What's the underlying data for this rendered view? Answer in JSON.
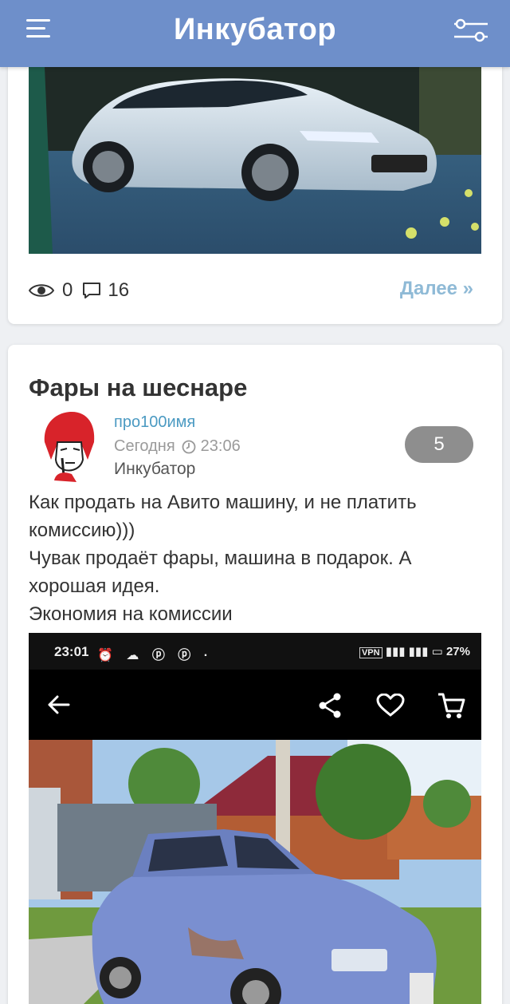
{
  "header": {
    "title": "Инкубатор",
    "menu_icon": "menu-icon",
    "filter_icon": "filter-sliders-icon",
    "color": "#6e8fca"
  },
  "prev_post": {
    "views": "0",
    "comments": "16",
    "more_label": "Далее »"
  },
  "post": {
    "title": "Фары на шеснаре",
    "author": "про100имя",
    "date": "Сегодня",
    "time": "23:06",
    "category": "Инкубатор",
    "rating": "5",
    "text_lines": [
      "Как продать на Авито машину, и не платить комиссию)))",
      "Чувак продаёт фары, машина в подарок. А хорошая идея.",
      "Экономия на комиссии"
    ],
    "screenshot": {
      "status_time": "23:01",
      "battery": "27%",
      "vpn": "VPN"
    }
  }
}
